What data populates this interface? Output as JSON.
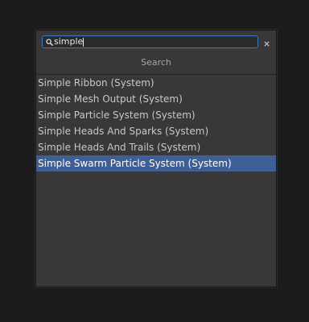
{
  "search": {
    "value": "simple",
    "clear_glyph": "×"
  },
  "section_title": "Search",
  "results": [
    {
      "label": "Simple Ribbon (System)",
      "selected": false
    },
    {
      "label": "Simple Mesh Output (System)",
      "selected": false
    },
    {
      "label": "Simple Particle System (System)",
      "selected": false
    },
    {
      "label": "Simple Heads And Sparks (System)",
      "selected": false
    },
    {
      "label": "Simple Heads And Trails (System)",
      "selected": false
    },
    {
      "label": "Simple Swarm Particle System (System)",
      "selected": true
    }
  ],
  "colors": {
    "background": "#1c1c1c",
    "panel": "#383838",
    "selection": "#3e5f96",
    "focus_border": "#3a79bb"
  },
  "icons": {
    "search": "search-icon",
    "clear": "close-icon"
  }
}
